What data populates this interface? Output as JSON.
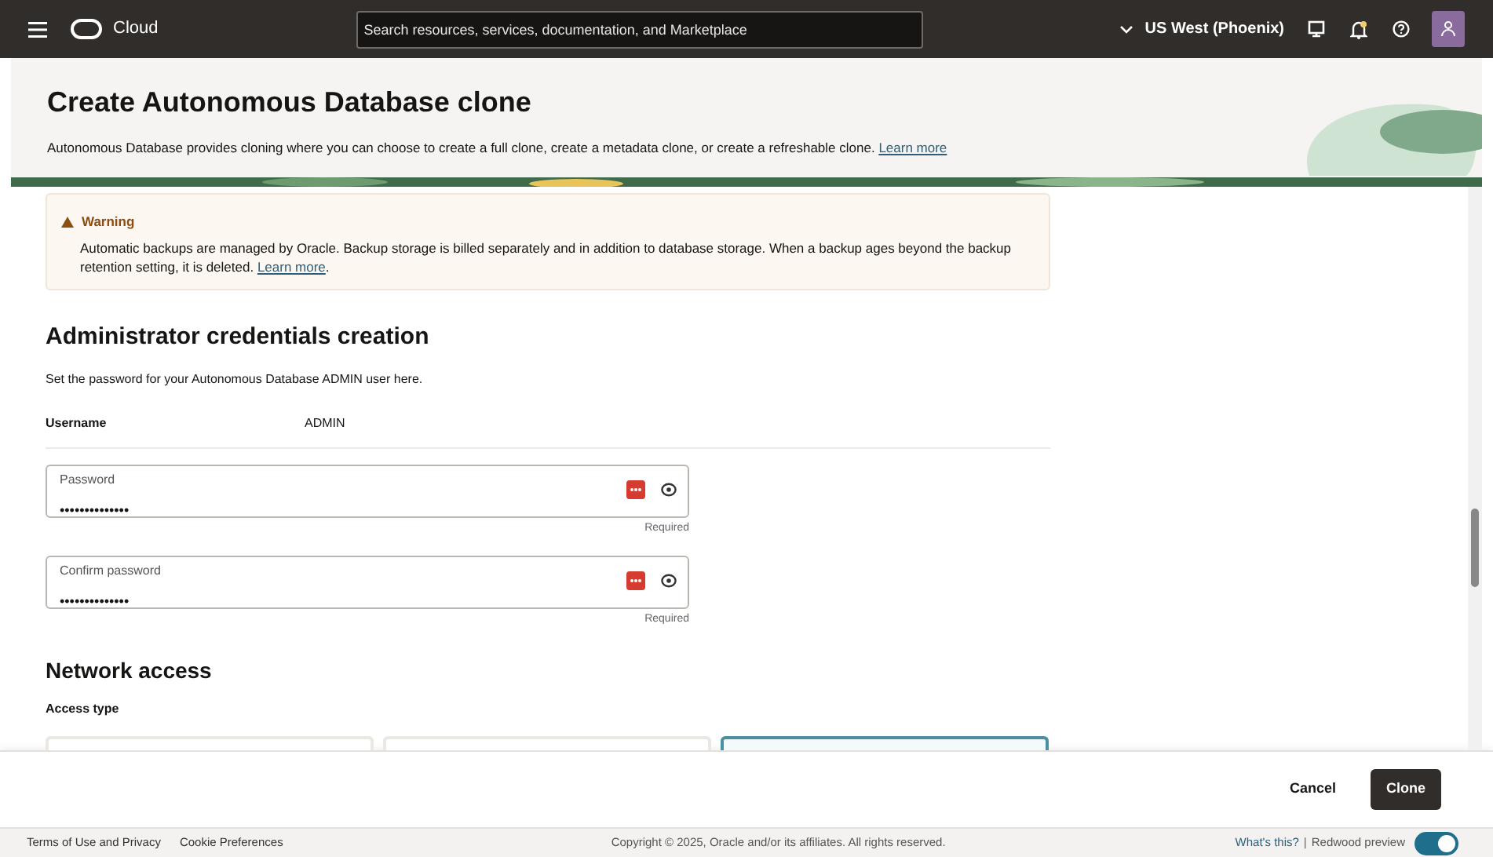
{
  "top_bar": {
    "brand": "Cloud",
    "search": {
      "placeholder": "Search resources, services, documentation, and Marketplace"
    },
    "region": "US West (Phoenix)"
  },
  "header": {
    "title": "Create Autonomous Database clone",
    "description": "Autonomous Database provides cloning where you can choose to create a full clone, create a metadata clone, or create a refreshable clone.",
    "link": "Learn more"
  },
  "warning": {
    "title": "Warning",
    "text": "Automatic backups are managed by Oracle. Backup storage is billed separately and in addition to database storage. When a backup ages beyond the backup retention setting, it is deleted.",
    "link": "Learn more",
    "after_link": "."
  },
  "credentials": {
    "heading": "Administrator credentials creation",
    "description": "Set the password for your Autonomous Database ADMIN user here.",
    "username_label": "Username",
    "username_value": "ADMIN",
    "fields": [
      {
        "label": "Password",
        "value": "••••••••••••••",
        "hint": "Required"
      },
      {
        "label": "Confirm password",
        "value": "••••••••••••••",
        "hint": "Required"
      }
    ]
  },
  "network": {
    "heading": "Network access",
    "access_type_label": "Access type",
    "access_type_options": [
      {
        "selected": false
      },
      {
        "selected": false
      },
      {
        "selected": true
      }
    ]
  },
  "actions": [
    "Cancel",
    "Clone"
  ],
  "footer": {
    "links": [
      "Terms of Use and Privacy",
      "Cookie Preferences"
    ],
    "copyright": "Copyright © 2025, Oracle and/or its affiliates. All rights reserved.",
    "whats_this": "What's this?",
    "separator": "|",
    "preview_label": "Redwood preview",
    "preview_on": true
  }
}
